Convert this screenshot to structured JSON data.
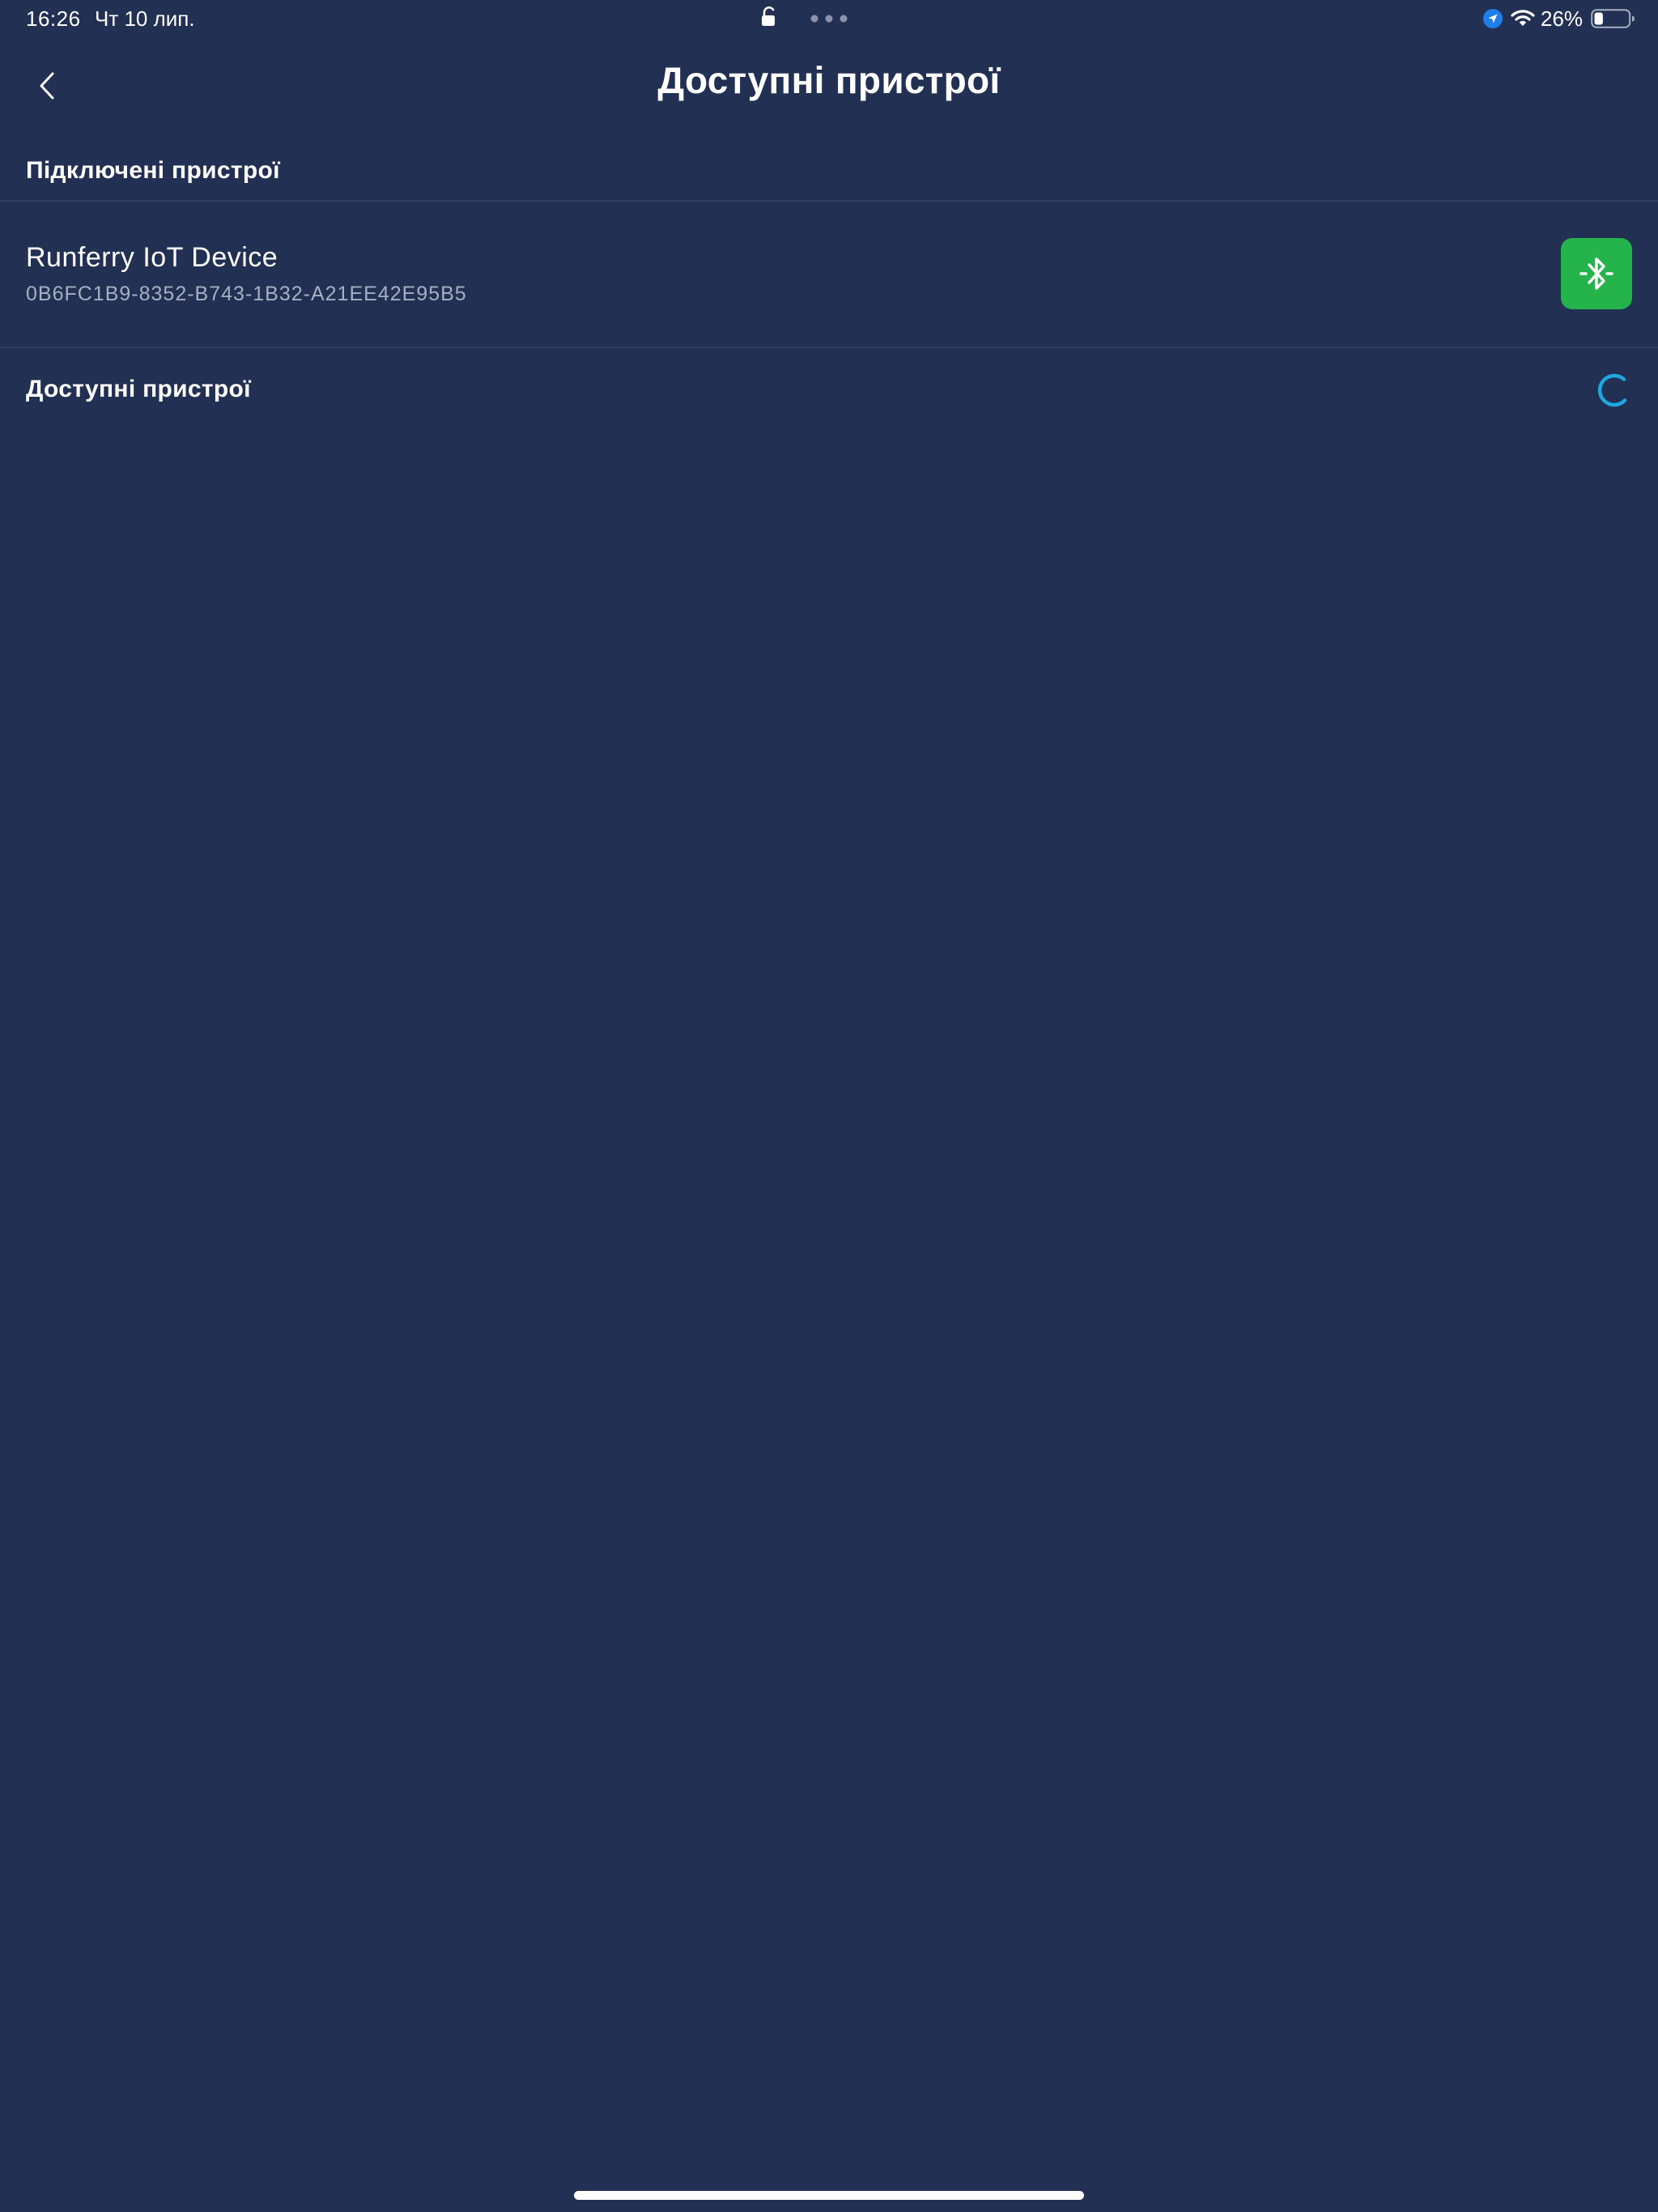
{
  "status_bar": {
    "time": "16:26",
    "date": "Чт 10 лип.",
    "battery_percent": "26%",
    "battery_level": 0.26,
    "icons": [
      "lock-icon",
      "more-dots-icon",
      "location-icon",
      "wifi-icon",
      "battery-icon"
    ]
  },
  "header": {
    "title": "Доступні пристрої",
    "back_icon": "chevron-left-icon"
  },
  "connected_section": {
    "title": "Підключені пристрої",
    "devices": [
      {
        "name": "Runferry IoT Device",
        "id": "0B6FC1B9-8352-B743-1B32-A21EE42E95B5",
        "action_icon": "bluetooth-icon"
      }
    ]
  },
  "available_section": {
    "title": "Доступні пристрої",
    "loading_icon": "spinner-icon"
  },
  "colors": {
    "background": "#223153",
    "accent_green": "#25b34b",
    "spinner": "#1fa7e0",
    "secondary_text": "#a7afc2"
  }
}
